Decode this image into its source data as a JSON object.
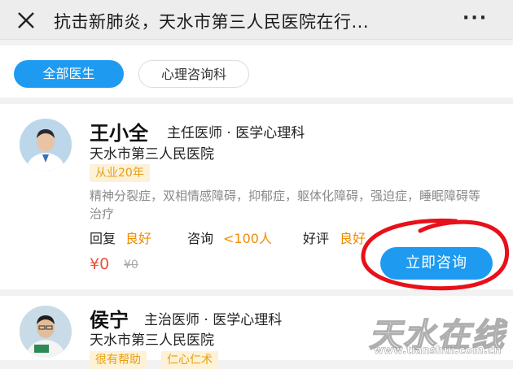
{
  "header": {
    "title": "抗击新肺炎，天水市第三人民医院在行...",
    "close_icon": "close-icon",
    "more_label": "···"
  },
  "filters": {
    "active": "全部医生",
    "other": "心理咨询科"
  },
  "doctors": [
    {
      "name": "王小全",
      "title": "主任医师 · 医学心理科",
      "hospital": "天水市第三人民医院",
      "tag": "从业20年",
      "specialty": "精神分裂症，双相情感障碍，抑郁症，躯体化障碍，强迫症，睡眠障碍等治疗",
      "stats": {
        "reply_label": "回复",
        "reply_value": "良好",
        "consult_label": "咨询",
        "consult_value": "<100人",
        "rating_label": "好评",
        "rating_value": "良好"
      },
      "price": "¥0",
      "original_price": "¥0",
      "button": "立即咨询"
    },
    {
      "name": "侯宁",
      "title": "主治医师 · 医学心理科",
      "hospital": "天水市第三人民医院",
      "tags": [
        "很有帮助",
        "仁心仁术"
      ]
    }
  ],
  "watermark": {
    "text": "天水在线",
    "url": "www.tianshui.com.cn"
  },
  "colors": {
    "accent": "#1e9bf0",
    "orange": "#f08c00",
    "price_red": "#e8533a",
    "annotation_red": "#e8101a"
  }
}
